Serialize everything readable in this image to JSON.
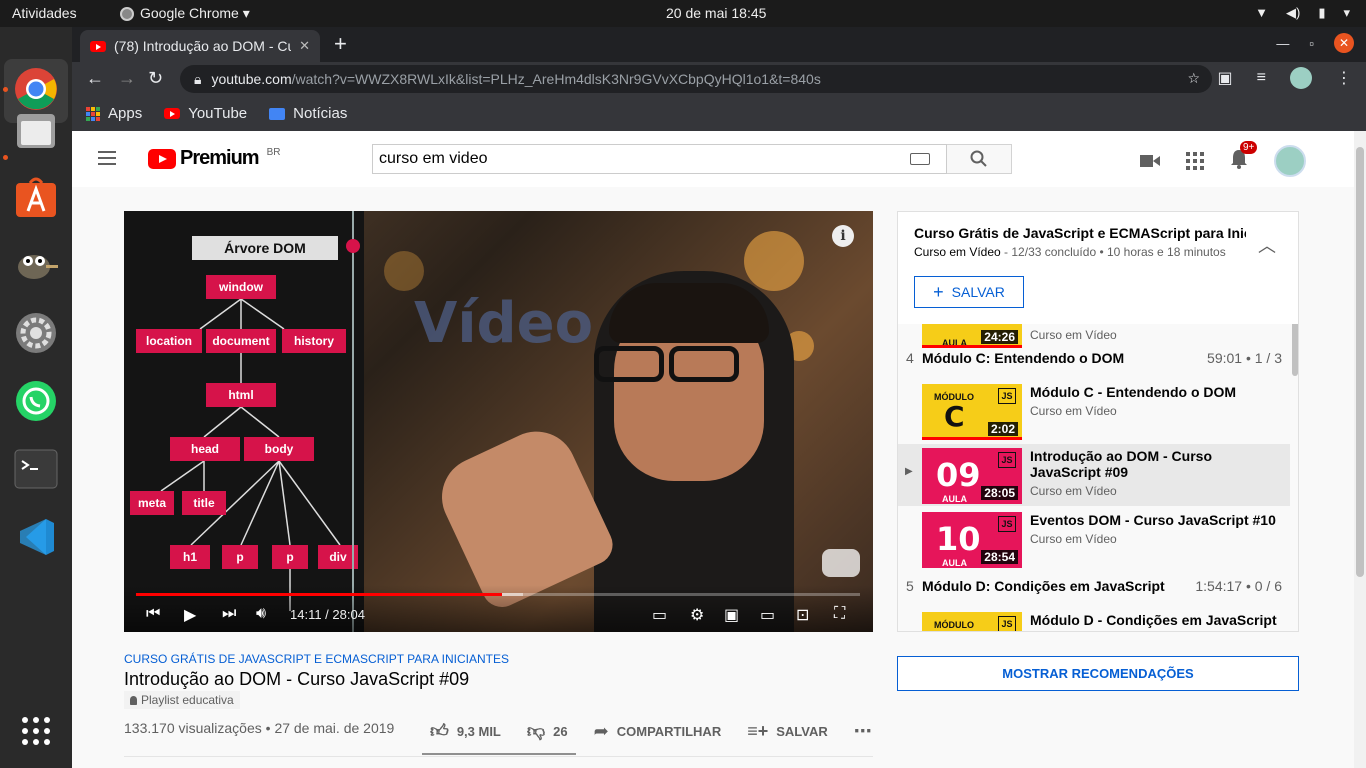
{
  "os": {
    "activities": "Atividades",
    "app_menu": "Google Chrome ▾",
    "clock": "20 de mai  18:45"
  },
  "browser": {
    "tab_title": "(78) Introdução ao DOM - Curso JavaScript #09",
    "url_host": "youtube.com",
    "url_rest": "/watch?v=WWZX8RWLxIk&list=PLHz_AreHm4dlsK3Nr9GVvXCbpQyHQl1o1&t=840s",
    "bookmarks": [
      "Apps",
      "YouTube",
      "Notícias"
    ]
  },
  "masthead": {
    "logo_word": "Premium",
    "country": "BR",
    "search_value": "curso em video",
    "notifications_badge": "9+"
  },
  "player": {
    "dom_title": "Árvore DOM",
    "dom_nodes": [
      "window",
      "location",
      "document",
      "history",
      "html",
      "head",
      "body",
      "meta",
      "title",
      "h1",
      "p",
      "p",
      "div"
    ],
    "background_text": "Vídeo",
    "current_time": "14:11",
    "duration": "28:04",
    "timer": "14:11 / 28:04",
    "progress_fraction": 0.505,
    "buffered_fraction": 0.535
  },
  "video": {
    "playlist_link": "CURSO GRÁTIS DE JAVASCRIPT E ECMASCRIPT PARA INICIANTES",
    "title": "Introdução ao DOM - Curso JavaScript #09",
    "chip": "Playlist educativa",
    "views_date": "133.170 visualizações • 27 de mai. de 2019",
    "likes": "9,3 MIL",
    "dislikes": "26",
    "share": "COMPARTILHAR",
    "save": "SALVAR"
  },
  "playlist": {
    "title": "Curso Grátis de JavaScript e ECMAScript para Iniciantes",
    "channel": "Curso em Vídeo",
    "progress": " - 12/33 concluído • 10 horas e 18 minutos",
    "save_label": "SALVAR",
    "sections": [
      {
        "num": "4",
        "name": "Módulo C: Entendendo o DOM",
        "meta": "59:01 • 1 / 3"
      },
      {
        "num": "5",
        "name": "Módulo D: Condições em JavaScript",
        "meta": "1:54:17 • 0 / 6"
      }
    ],
    "items": [
      {
        "title": "",
        "channel": "Curso em Vídeo",
        "duration": "24:26",
        "thumb_big": "",
        "thumb_small": "AULA"
      },
      {
        "title": "Módulo C - Entendendo o DOM",
        "channel": "Curso em Vídeo",
        "duration": "2:02",
        "thumb_big": "C",
        "thumb_small": "MÓDULO",
        "js": "JS"
      },
      {
        "title": "Introdução ao DOM - Curso JavaScript #09",
        "channel": "Curso em Vídeo",
        "duration": "28:05",
        "thumb_big": "09",
        "thumb_small": "AULA",
        "js": "JS",
        "marker": "▶"
      },
      {
        "title": "Eventos DOM - Curso JavaScript #10",
        "channel": "Curso em Vídeo",
        "duration": "28:54",
        "thumb_big": "10",
        "thumb_small": "AULA",
        "js": "JS"
      },
      {
        "title": "Módulo D - Condições em JavaScript",
        "channel": "",
        "duration": "",
        "thumb_big": "",
        "thumb_small": "MÓDULO",
        "js": "JS"
      }
    ]
  },
  "recommendations_button": "MOSTRAR RECOMENDAÇÕES"
}
